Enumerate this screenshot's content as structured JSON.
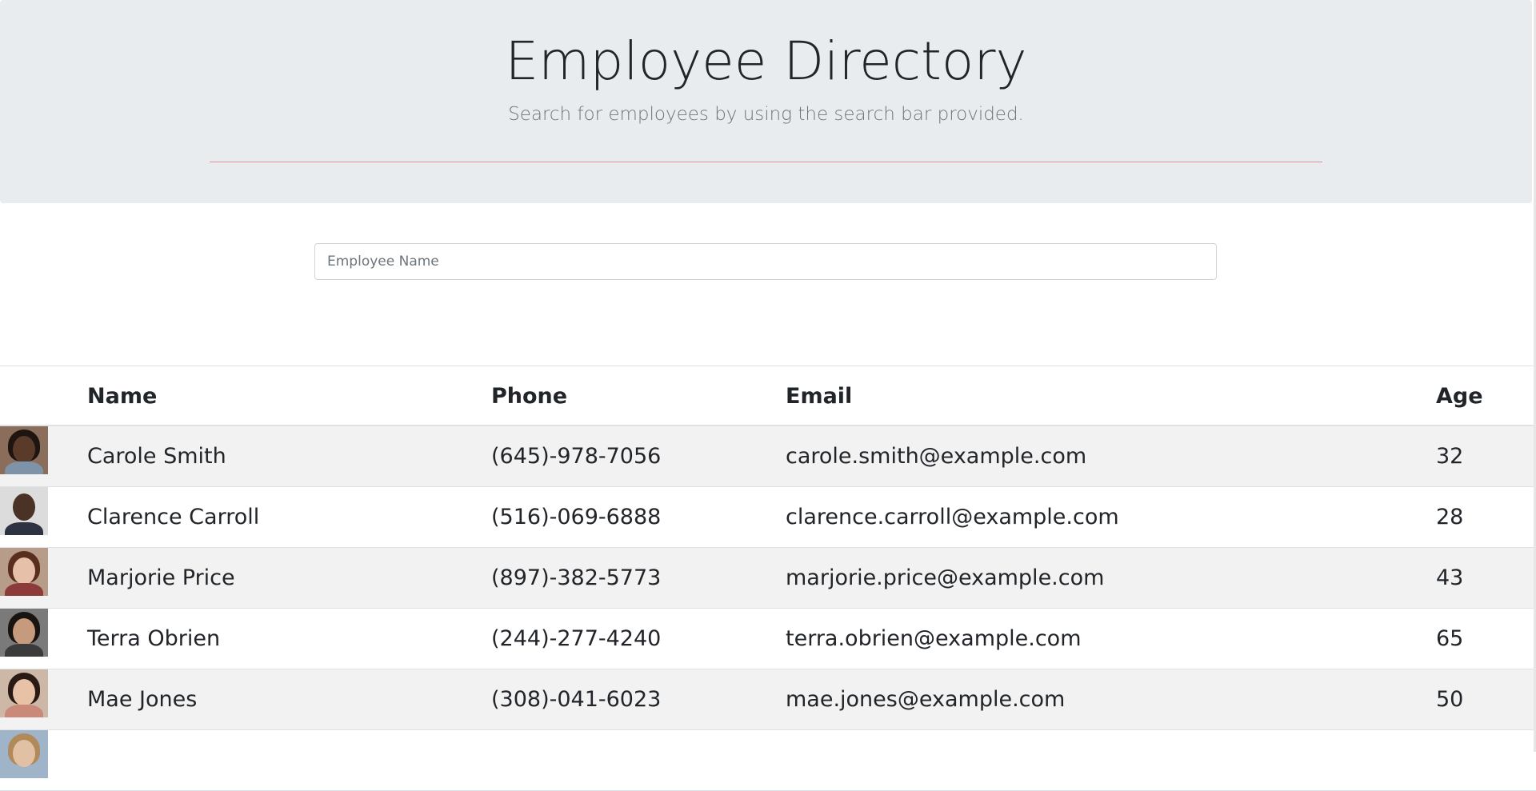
{
  "header": {
    "title": "Employee Directory",
    "subtitle": "Search for employees by using the search bar provided."
  },
  "search": {
    "placeholder": "Employee Name",
    "value": ""
  },
  "table": {
    "columns": [
      "",
      "Name",
      "Phone",
      "Email",
      "Age"
    ],
    "rows": [
      {
        "name": "Carole Smith",
        "phone": "(645)-978-7056",
        "email": "carole.smith@example.com",
        "age": "32",
        "avatar": "avatar-photo-woman"
      },
      {
        "name": "Clarence Carroll",
        "phone": "(516)-069-6888",
        "email": "clarence.carroll@example.com",
        "age": "28",
        "avatar": "avatar-photo-man"
      },
      {
        "name": "Marjorie Price",
        "phone": "(897)-382-5773",
        "email": "marjorie.price@example.com",
        "age": "43",
        "avatar": "avatar-photo-woman"
      },
      {
        "name": "Terra Obrien",
        "phone": "(244)-277-4240",
        "email": "terra.obrien@example.com",
        "age": "65",
        "avatar": "avatar-photo-woman"
      },
      {
        "name": "Mae Jones",
        "phone": "(308)-041-6023",
        "email": "mae.jones@example.com",
        "age": "50",
        "avatar": "avatar-photo-woman"
      },
      {
        "name": "",
        "phone": "",
        "email": "",
        "age": "",
        "avatar": "avatar-photo-woman"
      }
    ]
  },
  "colors": {
    "jumbotron_bg": "#e9ecef",
    "divider": "#e28e93",
    "stripe": "#f2f2f2"
  }
}
